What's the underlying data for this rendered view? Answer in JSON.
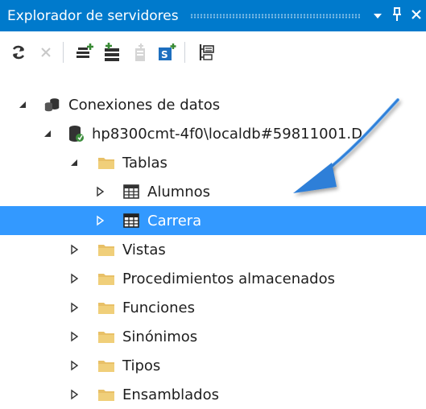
{
  "panel": {
    "title": "Explorador de servidores",
    "dropdown_icon": "dropdown-triangle-icon",
    "pin_icon": "pin-icon",
    "close_icon": "close-icon"
  },
  "toolbar": {
    "buttons": [
      {
        "name": "refresh-icon",
        "enabled": true
      },
      {
        "name": "stop-icon",
        "enabled": false
      },
      {
        "name": "connect-database-icon",
        "enabled": true
      },
      {
        "name": "connect-server-icon",
        "enabled": true
      },
      {
        "name": "connect-azure-icon",
        "enabled": false
      },
      {
        "name": "connect-sharepoint-icon",
        "enabled": true
      },
      {
        "name": "properties-icon",
        "enabled": true
      }
    ]
  },
  "tree": {
    "root": "Conexiones de datos",
    "connection": "hp8300cmt-4f0\\localdb#59811001.D",
    "tables_folder": "Tablas",
    "tables": [
      "Alumnos",
      "Carrera"
    ],
    "selected": "Carrera",
    "folders": [
      "Vistas",
      "Procedimientos almacenados",
      "Funciones",
      "Sinónimos",
      "Tipos",
      "Ensamblados"
    ]
  },
  "colors": {
    "accent": "#007acc",
    "selection": "#3399ff",
    "folder": "#e8c067",
    "callout_arrow": "#2f7fd8"
  }
}
